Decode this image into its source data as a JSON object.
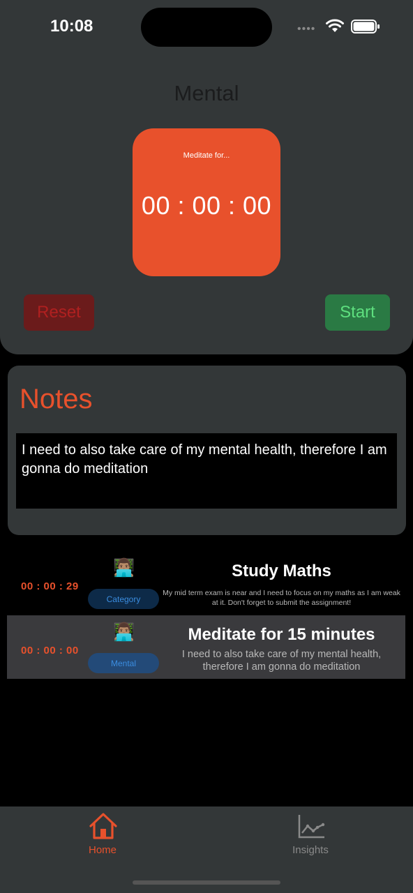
{
  "status_bar": {
    "time": "10:08",
    "dots": "••••"
  },
  "screen": {
    "title": "Mental"
  },
  "timer": {
    "caption": "Meditate for...",
    "value": "00 : 00 : 00"
  },
  "buttons": {
    "reset": "Reset",
    "start": "Start"
  },
  "notes": {
    "title": "Notes",
    "text": "I need to also take care of my mental health, therefore I am gonna do meditation"
  },
  "tasks": [
    {
      "time": "00 : 00 : 29",
      "emoji": "👨🏽‍💻",
      "badge": "Category",
      "title": "Study Maths",
      "description": "My mid term exam is near and I need to focus on my maths as I am weak at it. Don't forget to submit the assignment!"
    },
    {
      "time": "00 : 00 : 00",
      "emoji": "👨🏽‍💻",
      "badge": "Mental",
      "title": "Meditate for 15 minutes",
      "description": "I need to also take care of my mental health, therefore I am gonna do meditation"
    }
  ],
  "tab_bar": {
    "home": {
      "label": "Home",
      "icon": "home-icon"
    },
    "insights": {
      "label": "Insights",
      "icon": "chart-icon"
    }
  },
  "colors": {
    "accent": "#e8512c",
    "panel": "#333738",
    "reset": "#6b1b1b",
    "start": "#2a7a44",
    "badge_text": "#3b8de0"
  }
}
